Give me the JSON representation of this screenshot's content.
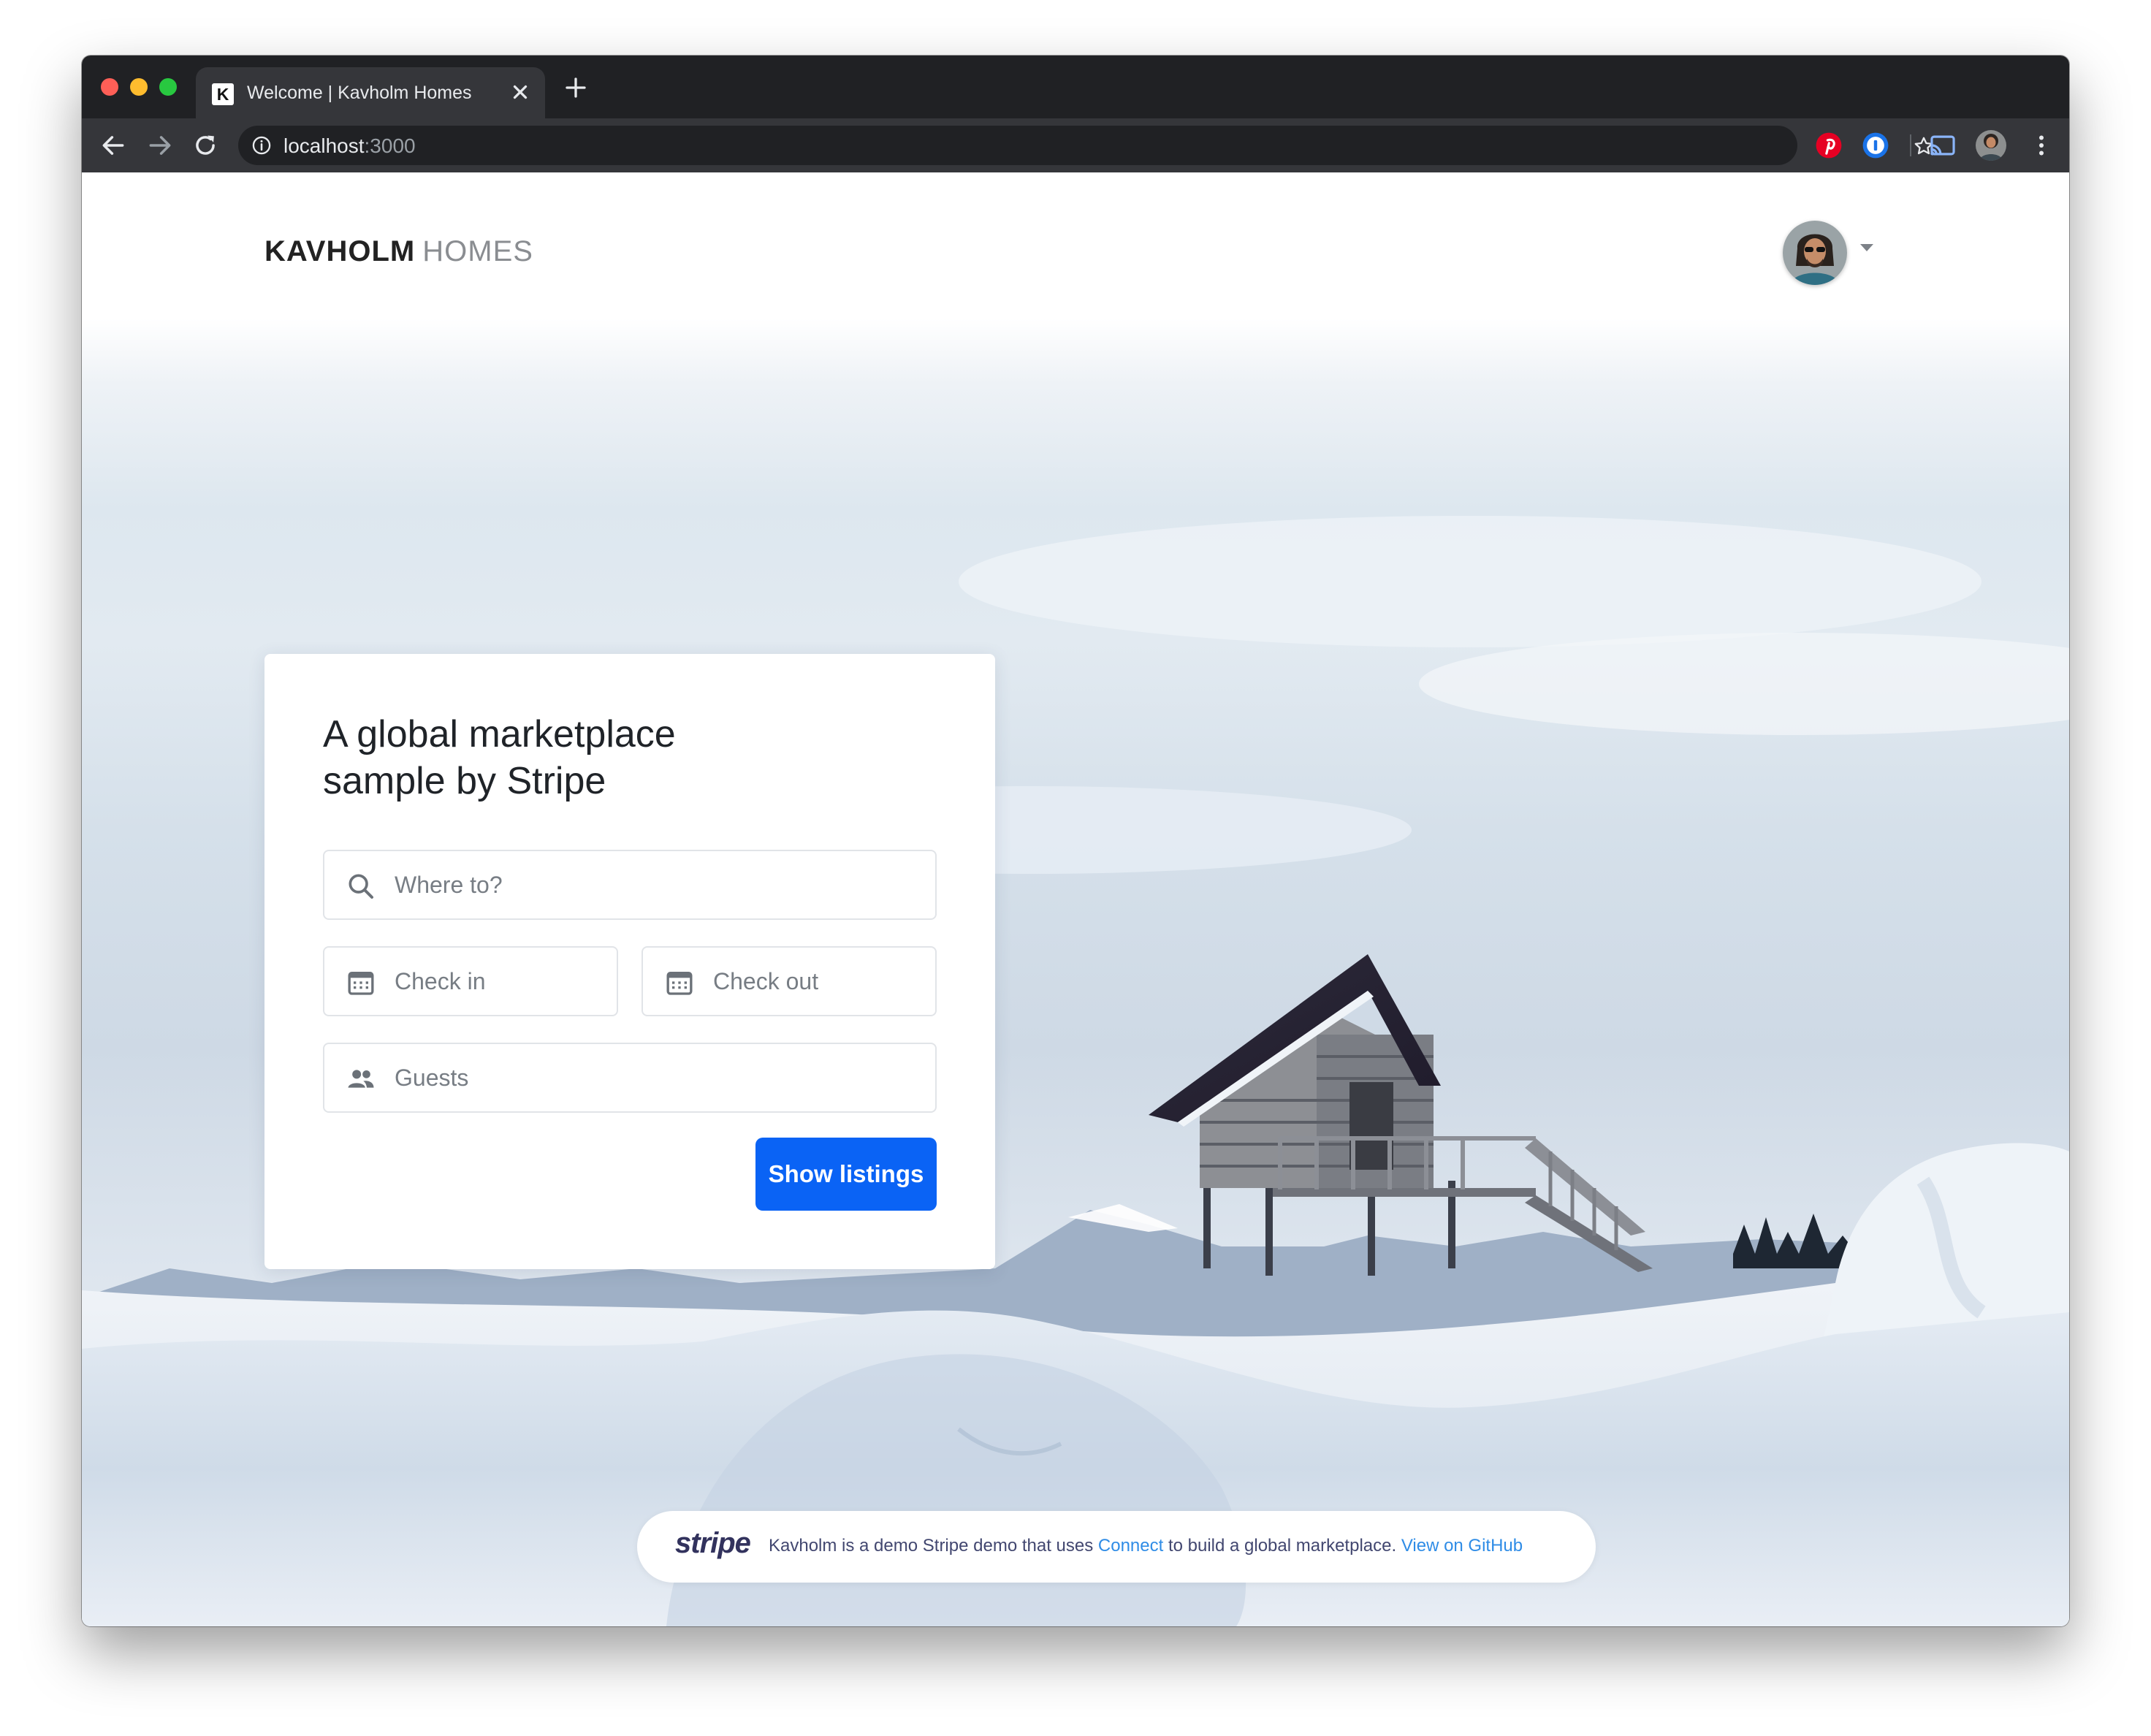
{
  "browser": {
    "tab_favicon_letter": "K",
    "tab_title": "Welcome | Kavholm Homes",
    "url_host": "localhost",
    "url_port": ":3000"
  },
  "page": {
    "logo_strong": "KAVHOLM",
    "logo_light": "HOMES",
    "search": {
      "title": "A global marketplace\nsample by Stripe",
      "where_placeholder": "Where to?",
      "checkin_placeholder": "Check in",
      "checkout_placeholder": "Check out",
      "guests_placeholder": "Guests",
      "submit_label": "Show listings"
    },
    "footer": {
      "logo": "stripe",
      "text_before": "Kavholm is a demo Stripe demo that uses ",
      "connect_link": "Connect",
      "text_middle": " to build a global marketplace. ",
      "github_link": "View on GitHub"
    }
  },
  "colors": {
    "primary_button": "#0a63f5",
    "link": "#2f8ce6",
    "chrome_dark": "#202124",
    "chrome_toolbar": "#35363a"
  },
  "icons": {
    "where": "search-icon",
    "checkin": "calendar-icon",
    "checkout": "calendar-icon",
    "guests": "people-icon"
  }
}
